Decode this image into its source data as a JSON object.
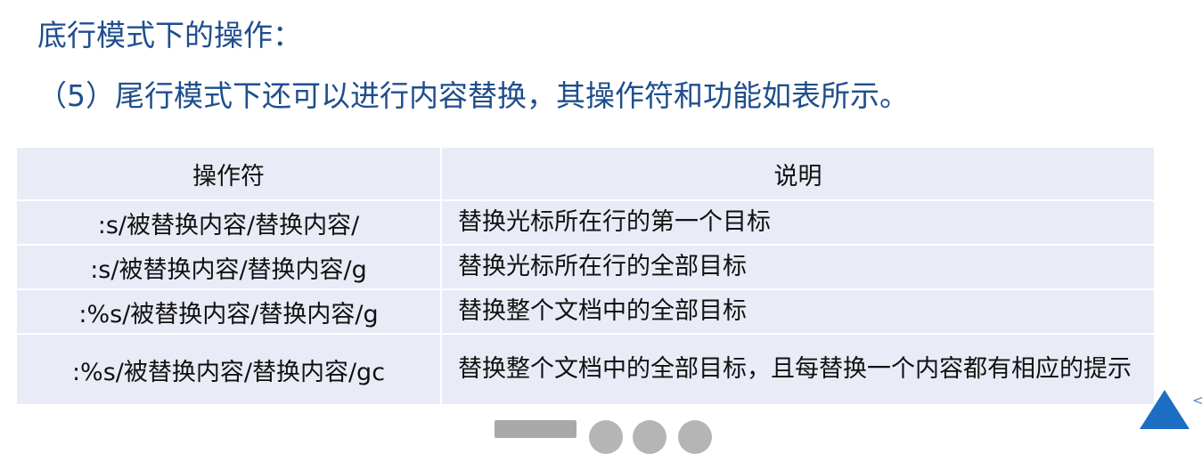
{
  "heading": "底行模式下的操作：",
  "subheading": "（5）尾行模式下还可以进行内容替换，其操作符和功能如表所示。",
  "table": {
    "headers": [
      "操作符",
      "说明"
    ],
    "rows": [
      {
        "op": ":s/被替换内容/替换内容/",
        "desc": "替换光标所在行的第一个目标"
      },
      {
        "op": ":s/被替换内容/替换内容/g",
        "desc": "替换光标所在行的全部目标"
      },
      {
        "op": ":%s/被替换内容/替换内容/g",
        "desc": "替换整个文档中的全部目标"
      },
      {
        "op": ":%s/被替换内容/替换内容/gc",
        "desc": "替换整个文档中的全部目标，且每替换一个内容都有相应的提示"
      }
    ]
  },
  "side_arrow": "<",
  "colors": {
    "heading_text": "#1f4e8c",
    "table_cell_bg": "#e9ecf6",
    "triangle": "#1b6ec2"
  },
  "icons": {
    "triangle": "triangle-up-icon",
    "side_arrow": "chevron-left-icon"
  }
}
